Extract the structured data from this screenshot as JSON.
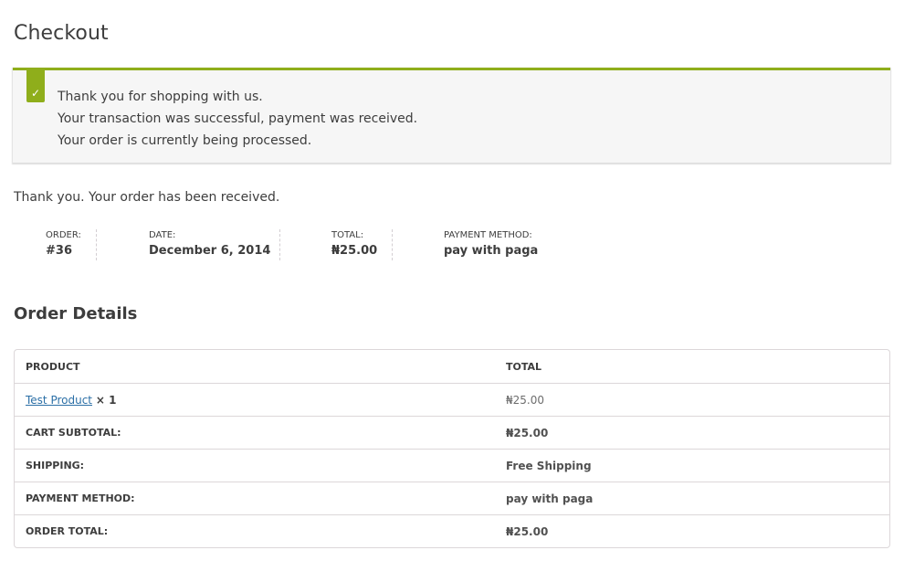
{
  "page": {
    "title": "Checkout"
  },
  "notice": {
    "icon": "checkmark-icon",
    "accent_color": "#8fae1b",
    "lines": [
      "Thank you for shopping with us.",
      "Your transaction was successful, payment was received.",
      "Your order is currently being processed."
    ]
  },
  "received_message": "Thank you. Your order has been received.",
  "overview": {
    "order": {
      "label": "ORDER:",
      "value": "#36"
    },
    "date": {
      "label": "DATE:",
      "value": "December 6, 2014"
    },
    "total": {
      "label": "TOTAL:",
      "value": "₦25.00"
    },
    "payment_method": {
      "label": "PAYMENT METHOD:",
      "value": "pay with paga"
    }
  },
  "order_details": {
    "title": "Order Details",
    "headers": {
      "product": "PRODUCT",
      "total": "TOTAL"
    },
    "item": {
      "name": "Test Product",
      "qty": "× 1",
      "total": "₦25.00"
    },
    "rows": [
      {
        "label": "CART SUBTOTAL:",
        "value": "₦25.00"
      },
      {
        "label": "SHIPPING:",
        "value": "Free Shipping"
      },
      {
        "label": "PAYMENT METHOD:",
        "value": "pay with paga"
      },
      {
        "label": "ORDER TOTAL:",
        "value": "₦25.00"
      }
    ]
  }
}
